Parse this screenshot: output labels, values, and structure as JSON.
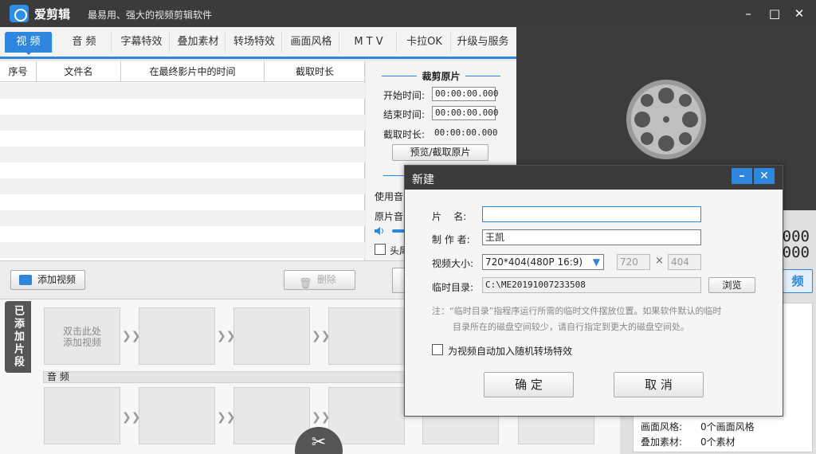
{
  "app": {
    "name": "爱剪辑",
    "slogan": "最易用、强大的视频剪辑软件",
    "minimize": "–",
    "maximize": "□",
    "close": "✕"
  },
  "tabs": [
    {
      "label": "视 频"
    },
    {
      "label": "音 频"
    },
    {
      "label": "字幕特效"
    },
    {
      "label": "叠加素材"
    },
    {
      "label": "转场特效"
    },
    {
      "label": "画面风格"
    },
    {
      "label": "M T V"
    },
    {
      "label": "卡拉OK"
    },
    {
      "label": "升级与服务"
    }
  ],
  "file_table": {
    "columns": [
      "序号",
      "文件名",
      "在最终影片中的时间",
      "截取时长"
    ]
  },
  "trim": {
    "title": "裁剪原片",
    "start_label": "开始时间:",
    "start_value": "00:00:00.000",
    "end_label": "结束时间:",
    "end_value": "00:00:00.000",
    "duration_label": "截取时长:",
    "duration_value": "00:00:00.000",
    "preview_button": "预览/截取原片",
    "use_audio_label": "使用音",
    "orig_audio_label": "原片音",
    "head_label": "头尾"
  },
  "actions": {
    "add_video": "添加视频",
    "delete": "删除"
  },
  "timeline": {
    "add_clip_tab": "已添加片段",
    "first_clip_hint": "双击此处\n添加视频",
    "audio_label": "音 频",
    "scissor_icon": "✂"
  },
  "right_panel": {
    "counter_top": "000",
    "counter_bottom": "000",
    "video_button_partial": "频",
    "info": [
      {
        "label": "画面风格:",
        "value": "0个画面风格"
      },
      {
        "label": "叠加素材:",
        "value": "0个素材"
      }
    ]
  },
  "dialog": {
    "title": "新建",
    "name_label": "片    名:",
    "name_value": "",
    "author_label": "制 作 者:",
    "author_value": "王凯",
    "size_label": "视频大小:",
    "size_value": "720*404(480P 16:9)",
    "width_value": "720",
    "times": "×",
    "height_value": "404",
    "temp_label": "临时目录:",
    "temp_value": "C:\\ME20191007233508",
    "browse_button": "浏览",
    "note_line1": "注：“临时目录”指程序运行所需的临时文件摆放位置。如果软件默认的临时",
    "note_line2": "目录所在的磁盘空间较少，请自行指定到更大的磁盘空间处。",
    "auto_transition_label": "为视频自动加入随机转场特效",
    "ok_button": "确 定",
    "cancel_button": "取 消"
  }
}
